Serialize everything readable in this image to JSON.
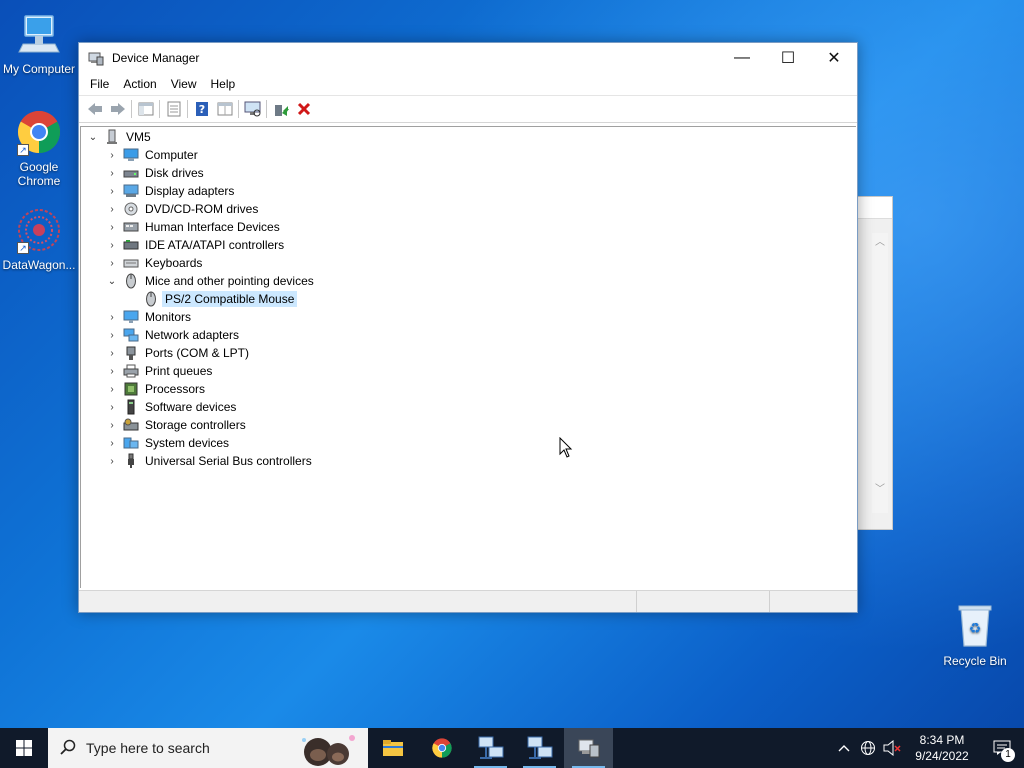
{
  "desktop": {
    "icons": [
      {
        "label": "My Computer",
        "icon": "computer-icon"
      },
      {
        "label": "Google Chrome",
        "icon": "chrome-icon"
      },
      {
        "label": "DataWagon...",
        "icon": "datawagon-icon"
      },
      {
        "label": "Recycle Bin",
        "icon": "recycle-bin-icon"
      }
    ]
  },
  "window": {
    "title": "Device Manager",
    "controls": {
      "minimize": "—",
      "maximize": "☐",
      "close": "✕"
    },
    "menu": [
      "File",
      "Action",
      "View",
      "Help"
    ],
    "toolbar": [
      "back-icon",
      "forward-icon",
      "show-hide-console-tree-icon",
      "properties-icon",
      "help-icon",
      "view-icon",
      "scan-hardware-icon",
      "update-driver-icon",
      "uninstall-icon"
    ],
    "tree": {
      "root": "VM5",
      "categories": [
        {
          "label": "Computer",
          "icon": "computer-icon",
          "expanded": false
        },
        {
          "label": "Disk drives",
          "icon": "disk-drive-icon",
          "expanded": false
        },
        {
          "label": "Display adapters",
          "icon": "display-adapter-icon",
          "expanded": false
        },
        {
          "label": "DVD/CD-ROM drives",
          "icon": "dvd-icon",
          "expanded": false
        },
        {
          "label": "Human Interface Devices",
          "icon": "hid-icon",
          "expanded": false
        },
        {
          "label": "IDE ATA/ATAPI controllers",
          "icon": "ide-controller-icon",
          "expanded": false
        },
        {
          "label": "Keyboards",
          "icon": "keyboard-icon",
          "expanded": false
        },
        {
          "label": "Mice and other pointing devices",
          "icon": "mouse-icon",
          "expanded": true,
          "children": [
            "PS/2 Compatible Mouse"
          ]
        },
        {
          "label": "Monitors",
          "icon": "monitor-icon",
          "expanded": false
        },
        {
          "label": "Network adapters",
          "icon": "network-adapter-icon",
          "expanded": false
        },
        {
          "label": "Ports (COM & LPT)",
          "icon": "port-icon",
          "expanded": false
        },
        {
          "label": "Print queues",
          "icon": "printer-icon",
          "expanded": false
        },
        {
          "label": "Processors",
          "icon": "processor-icon",
          "expanded": false
        },
        {
          "label": "Software devices",
          "icon": "software-device-icon",
          "expanded": false
        },
        {
          "label": "Storage controllers",
          "icon": "storage-controller-icon",
          "expanded": false
        },
        {
          "label": "System devices",
          "icon": "system-device-icon",
          "expanded": false
        },
        {
          "label": "Universal Serial Bus controllers",
          "icon": "usb-icon",
          "expanded": false
        }
      ]
    }
  },
  "taskbar": {
    "search_placeholder": "Type here to search",
    "apps": [
      "file-explorer-icon",
      "chrome-icon",
      "network-app-icon",
      "network-app-icon",
      "device-manager-icon"
    ],
    "clock": {
      "time": "8:34 PM",
      "date": "9/24/2022"
    },
    "notification_count": "1"
  },
  "colors": {
    "selection": "#cce8ff",
    "taskbar": "#101a2a",
    "accent": "#76b9ed"
  }
}
